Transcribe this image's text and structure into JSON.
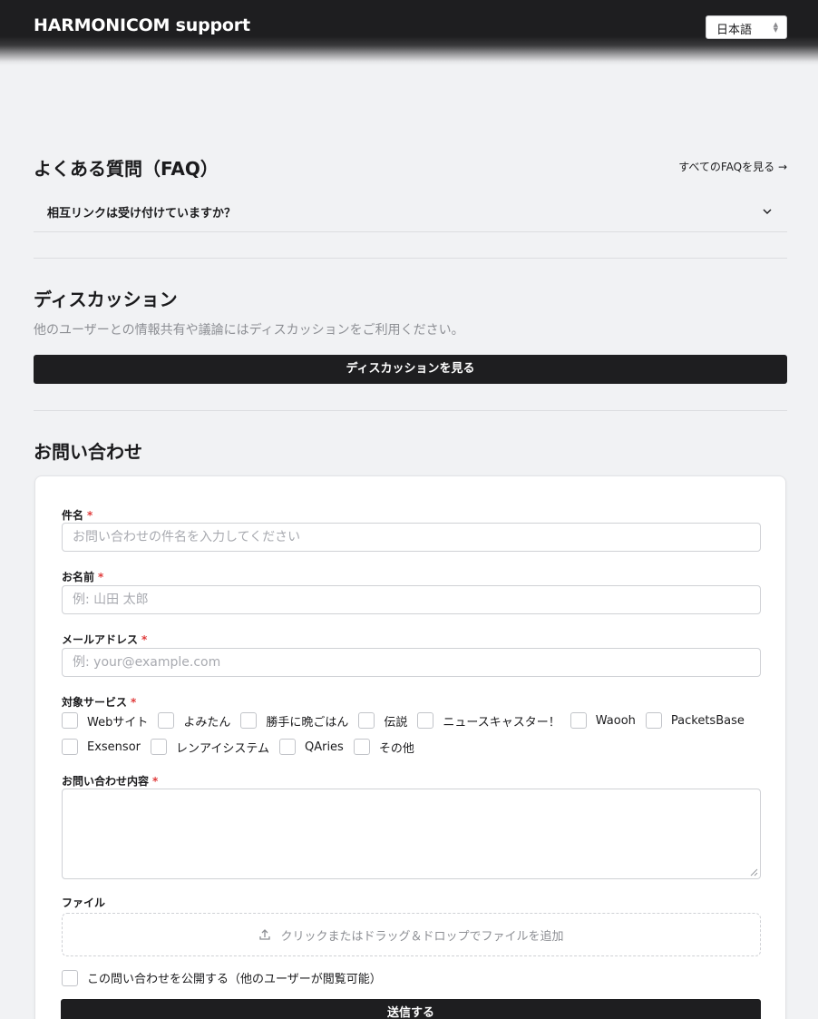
{
  "header": {
    "brand": "HARMONICOM support",
    "language": "日本語"
  },
  "faq": {
    "title": "よくある質問（FAQ）",
    "view_all": "すべてのFAQを見る →",
    "items": [
      {
        "question": "相互リンクは受け付けていますか？"
      }
    ]
  },
  "discussion": {
    "title": "ディスカッション",
    "description": "他のユーザーとの情報共有や議論にはディスカッションをご利用ください。",
    "button": "ディスカッションを見る"
  },
  "contact": {
    "title": "お問い合わせ",
    "required_mark": "*",
    "subject": {
      "label": "件名",
      "placeholder": "お問い合わせの件名を入力してください",
      "value": ""
    },
    "name": {
      "label": "お名前",
      "placeholder": "例: 山田 太郎",
      "value": ""
    },
    "email": {
      "label": "メールアドレス",
      "placeholder": "例: your@example.com",
      "value": ""
    },
    "services": {
      "label": "対象サービス",
      "options": [
        "Webサイト",
        "よみたん",
        "勝手に晩ごはん",
        "伝説",
        "ニュースキャスター！",
        "Waooh",
        "PacketsBase",
        "Exsensor",
        "レンアイシステム",
        "QAries",
        "その他"
      ]
    },
    "message": {
      "label": "お問い合わせ内容",
      "value": ""
    },
    "file": {
      "label": "ファイル",
      "dropzone": "クリックまたはドラッグ＆ドロップでファイルを追加"
    },
    "publish": {
      "label": "この問い合わせを公開する（他のユーザーが閲覧可能）",
      "checked": false
    },
    "submit": "送信する"
  }
}
